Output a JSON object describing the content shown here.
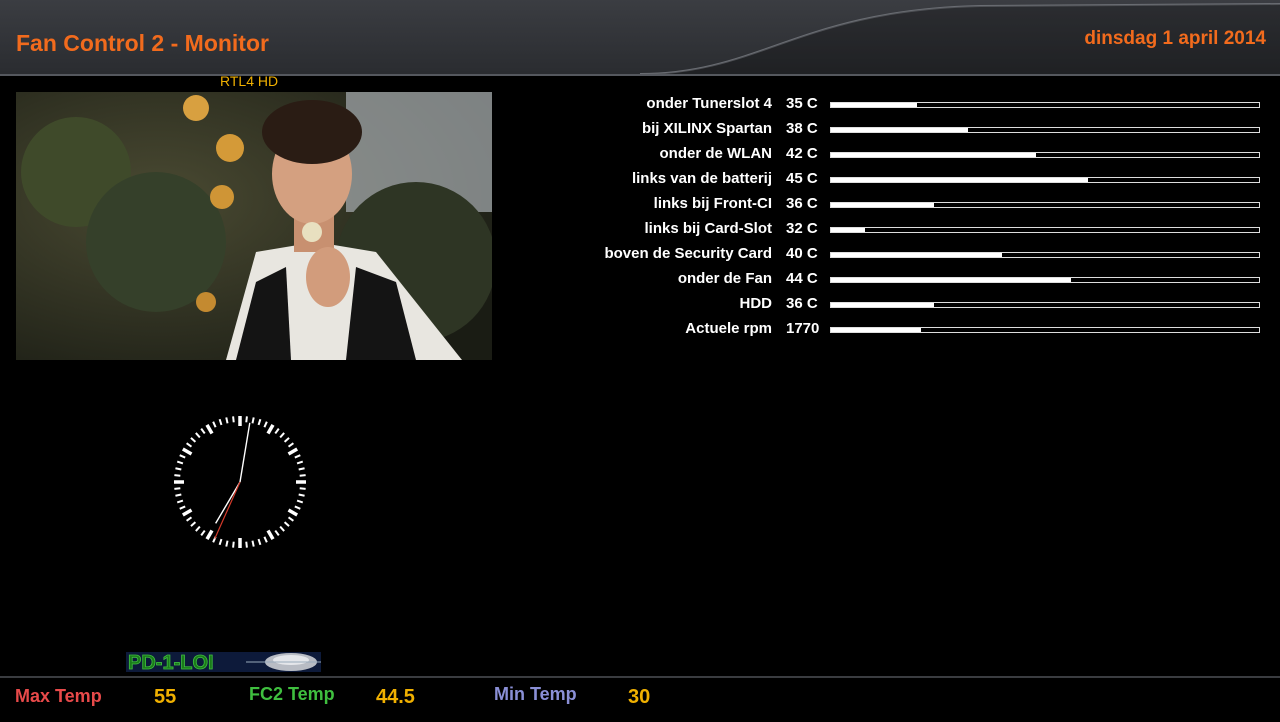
{
  "header": {
    "title": "Fan Control 2 - Monitor",
    "date": "dinsdag  1 april 2014"
  },
  "preview": {
    "channel": "RTL4 HD"
  },
  "sensors": [
    {
      "label": "onder Tunerslot 4",
      "value": "35 C",
      "level": 0.2
    },
    {
      "label": "bij XILINX Spartan",
      "value": "38 C",
      "level": 0.32
    },
    {
      "label": "onder de WLAN",
      "value": "42 C",
      "level": 0.48
    },
    {
      "label": "links van de batterij",
      "value": "45 C",
      "level": 0.6
    },
    {
      "label": "links bij Front-CI",
      "value": "36 C",
      "level": 0.24
    },
    {
      "label": "links bij Card-Slot",
      "value": "32 C",
      "level": 0.08
    },
    {
      "label": "boven de Security Card",
      "value": "40 C",
      "level": 0.4
    },
    {
      "label": "onder de Fan",
      "value": "44 C",
      "level": 0.56
    },
    {
      "label": "HDD",
      "value": "36 C",
      "level": 0.24
    },
    {
      "label": "Actuele rpm",
      "value": "1770",
      "level": 0.21
    }
  ],
  "clock": {
    "hour": 7,
    "minute": 1,
    "second": 34
  },
  "logo": {
    "text": "PD-1-LOI"
  },
  "footer": {
    "max_label": "Max Temp",
    "max_value": "55",
    "fc2_label": "FC2 Temp",
    "fc2_value": "44.5",
    "min_label": "Min Temp",
    "min_value": "30"
  },
  "colors": {
    "accent": "#f26b1d",
    "value_yellow": "#f0b000",
    "max_label": "#e84a4a",
    "fc2_label": "#3fbf3f",
    "min_label": "#8a8fd6"
  }
}
